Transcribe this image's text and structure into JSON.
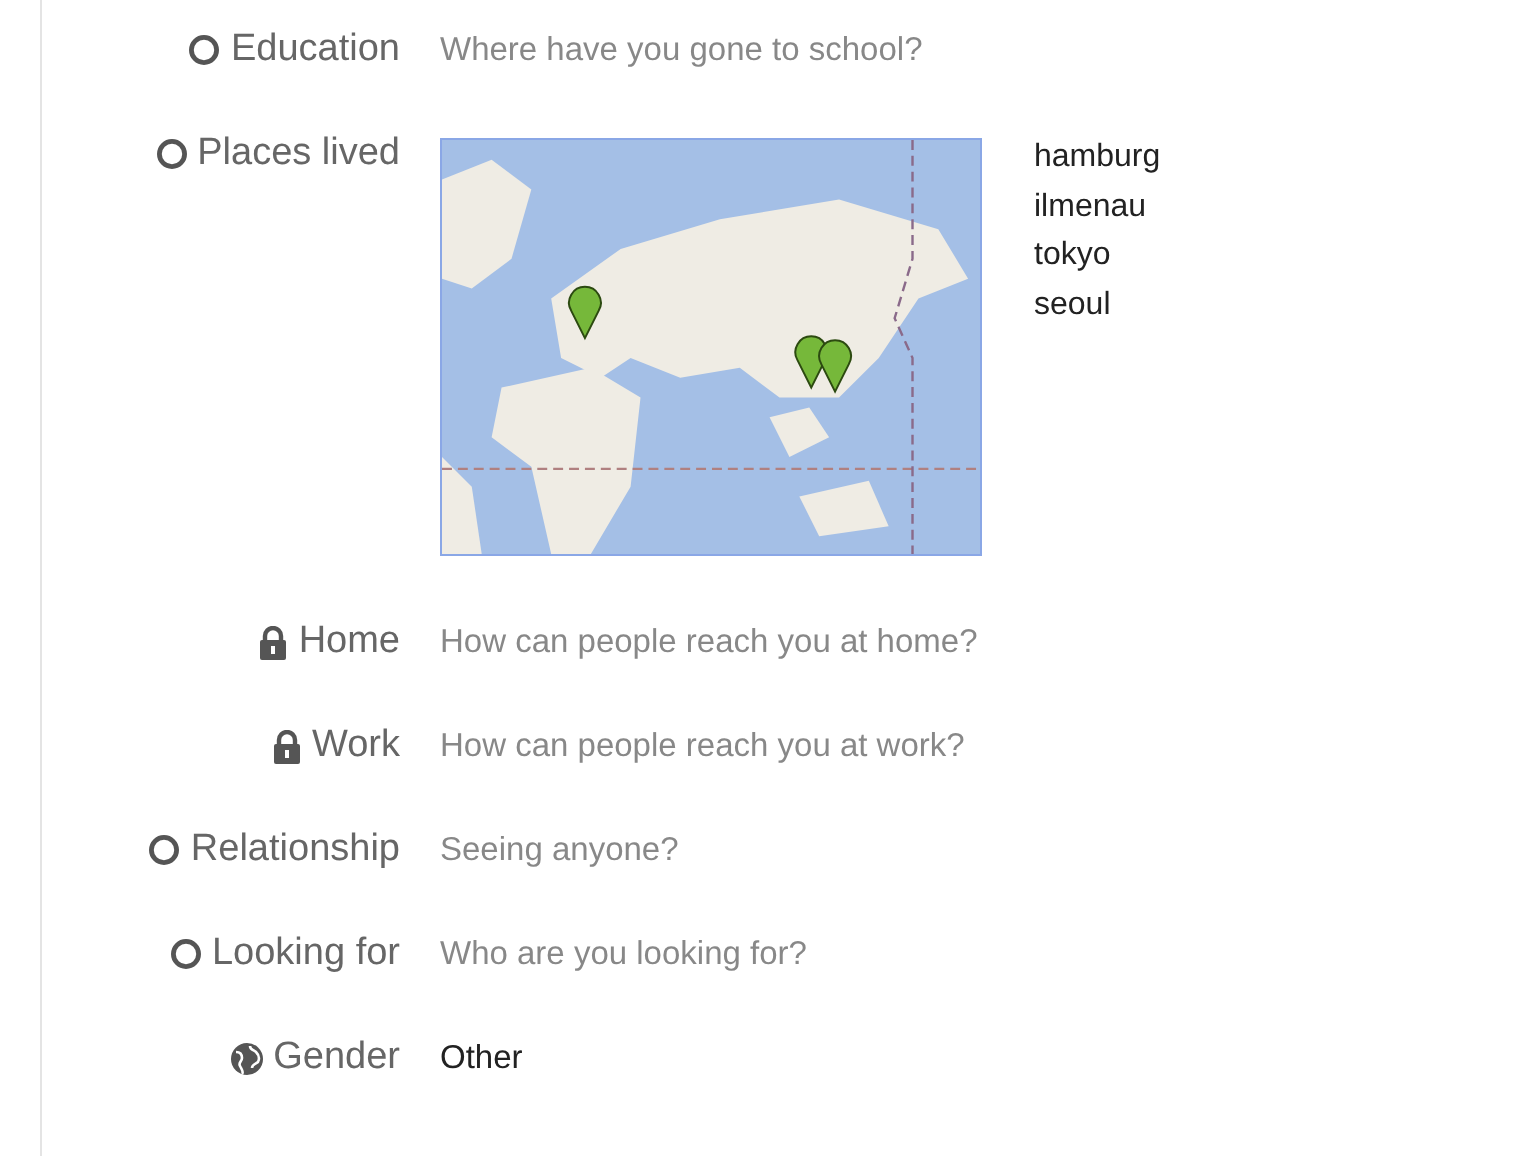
{
  "fields": [
    {
      "kind": "text",
      "label": "Education",
      "icon": {
        "kind": "circle"
      },
      "placeholder": "Where have you gone to school?"
    },
    {
      "kind": "map",
      "label": "Places lived",
      "icon": {
        "kind": "circle"
      },
      "places": [
        "hamburg",
        "ilmenau",
        "tokyo",
        "seoul"
      ]
    },
    {
      "kind": "text",
      "label": "Home",
      "icon": {
        "kind": "lock"
      },
      "placeholder": "How can people reach you at home?"
    },
    {
      "kind": "text",
      "label": "Work",
      "icon": {
        "kind": "lock"
      },
      "placeholder": "How can people reach you at work?"
    },
    {
      "kind": "text",
      "label": "Relationship",
      "icon": {
        "kind": "circle"
      },
      "placeholder": "Seeing anyone?"
    },
    {
      "kind": "text",
      "label": "Looking for",
      "icon": {
        "kind": "circle"
      },
      "placeholder": "Who are you looking for?"
    },
    {
      "kind": "text",
      "label": "Gender",
      "icon": {
        "kind": "globe"
      },
      "value": "Other"
    }
  ]
}
